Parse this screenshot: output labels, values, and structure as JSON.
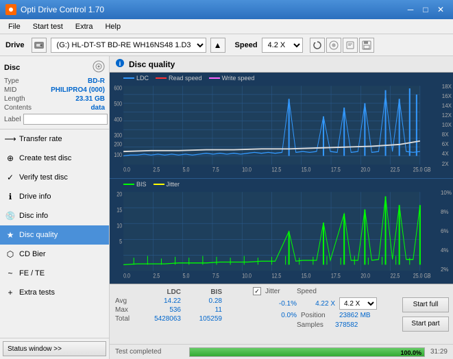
{
  "titleBar": {
    "title": "Opti Drive Control 1.70",
    "iconText": "O",
    "minimizeBtn": "─",
    "maximizeBtn": "□",
    "closeBtn": "✕"
  },
  "menuBar": {
    "items": [
      "File",
      "Start test",
      "Extra",
      "Help"
    ]
  },
  "driveBar": {
    "driveLabel": "Drive",
    "driveValue": "(G:)  HL-DT-ST BD-RE  WH16NS48 1.D3",
    "speedLabel": "Speed",
    "speedValue": "4.2 X"
  },
  "discPanel": {
    "title": "Disc",
    "typeLabel": "Type",
    "typeValue": "BD-R",
    "midLabel": "MID",
    "midValue": "PHILIPRO4 (000)",
    "lengthLabel": "Length",
    "lengthValue": "23.31 GB",
    "contentsLabel": "Contents",
    "contentsValue": "data",
    "labelLabel": "Label"
  },
  "navItems": [
    {
      "id": "transfer-rate",
      "label": "Transfer rate",
      "icon": "⟶"
    },
    {
      "id": "create-test-disc",
      "label": "Create test disc",
      "icon": "⊕"
    },
    {
      "id": "verify-test-disc",
      "label": "Verify test disc",
      "icon": "✓"
    },
    {
      "id": "drive-info",
      "label": "Drive info",
      "icon": "ℹ"
    },
    {
      "id": "disc-info",
      "label": "Disc info",
      "icon": "💿"
    },
    {
      "id": "disc-quality",
      "label": "Disc quality",
      "icon": "★",
      "active": true
    },
    {
      "id": "cd-bier",
      "label": "CD Bier",
      "icon": "🍺"
    },
    {
      "id": "fe-te",
      "label": "FE / TE",
      "icon": "~"
    },
    {
      "id": "extra-tests",
      "label": "Extra tests",
      "icon": "+"
    }
  ],
  "statusWindow": {
    "buttonLabel": "Status window >>"
  },
  "discQuality": {
    "title": "Disc quality"
  },
  "chart1": {
    "legend": [
      {
        "label": "LDC",
        "color": "#3399ff"
      },
      {
        "label": "Read speed",
        "color": "#ff3333"
      },
      {
        "label": "Write speed",
        "color": "#ff66ff"
      }
    ],
    "yAxisRight": [
      "18X",
      "16X",
      "14X",
      "12X",
      "10X",
      "8X",
      "6X",
      "4X",
      "2X"
    ],
    "yAxisLeft": [
      "600",
      "500",
      "400",
      "300",
      "200",
      "100"
    ],
    "xAxisLabels": [
      "0.0",
      "2.5",
      "5.0",
      "7.5",
      "10.0",
      "12.5",
      "15.0",
      "17.5",
      "20.0",
      "22.5",
      "25.0 GB"
    ]
  },
  "chart2": {
    "legend": [
      {
        "label": "BIS",
        "color": "#00ff00"
      },
      {
        "label": "Jitter",
        "color": "#ffff00"
      }
    ],
    "yAxisRight": [
      "10%",
      "8%",
      "6%",
      "4%",
      "2%"
    ],
    "yAxisLeft": [
      "20",
      "15",
      "10",
      "5"
    ],
    "xAxisLabels": [
      "0.0",
      "2.5",
      "5.0",
      "7.5",
      "10.0",
      "12.5",
      "15.0",
      "17.5",
      "20.0",
      "22.5",
      "25.0 GB"
    ]
  },
  "stats": {
    "headers": [
      "",
      "LDC",
      "BIS",
      "",
      "Jitter",
      "Speed",
      ""
    ],
    "avgLabel": "Avg",
    "avgLDC": "14.22",
    "avgBIS": "0.28",
    "avgJitter": "-0.1%",
    "maxLabel": "Max",
    "maxLDC": "536",
    "maxBIS": "11",
    "maxJitter": "0.0%",
    "totalLabel": "Total",
    "totalLDC": "5428063",
    "totalBIS": "105259",
    "speedValue": "4.22 X",
    "speedSelectValue": "4.2 X",
    "positionLabel": "Position",
    "positionValue": "23862 MB",
    "samplesLabel": "Samples",
    "samplesValue": "378582",
    "startFullBtn": "Start full",
    "startPartBtn": "Start part"
  },
  "progressBar": {
    "statusText": "Test completed",
    "percentage": "100.0%",
    "time": "31:29",
    "fillPercent": 100
  }
}
